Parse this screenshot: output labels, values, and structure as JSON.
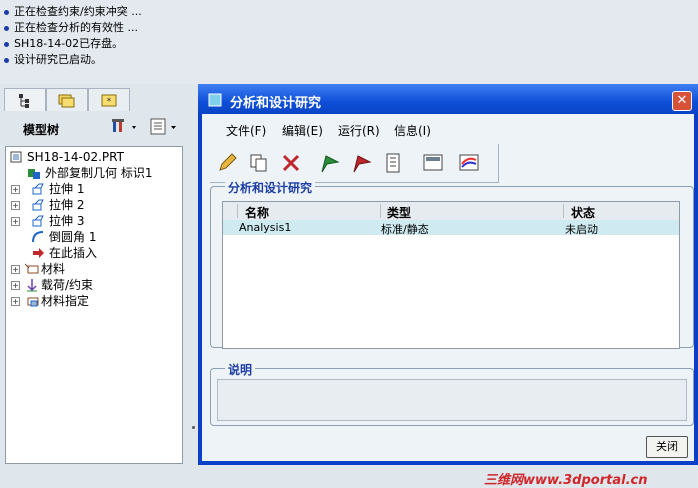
{
  "messages": [
    "正在检查约束/约束冲突 ...",
    "正在检查分析的有效性 ...",
    "SH18-14-02已存盘。",
    "设计研究已启动。"
  ],
  "model_tree": {
    "title": "模型树",
    "root": "SH18-14-02.PRT",
    "nodes": [
      {
        "label": "外部复制几何 标识1",
        "expandable": false
      },
      {
        "label": "拉伸 1",
        "expandable": true
      },
      {
        "label": "拉伸 2",
        "expandable": true
      },
      {
        "label": "拉伸 3",
        "expandable": true
      },
      {
        "label": "倒圆角 1",
        "expandable": false
      },
      {
        "label": "在此插入",
        "expandable": false
      },
      {
        "label": "材料",
        "expandable": true
      },
      {
        "label": "载荷/约束",
        "expandable": true
      },
      {
        "label": "材料指定",
        "expandable": true
      }
    ]
  },
  "dialog": {
    "title": "分析和设计研究",
    "menus": [
      "文件(F)",
      "编辑(E)",
      "运行(R)",
      "信息(I)"
    ],
    "group_title": "分析和设计研究",
    "columns": [
      "名称",
      "类型",
      "状态"
    ],
    "rows": [
      {
        "name": "Analysis1",
        "type": "标准/静态",
        "status": "未启动"
      }
    ],
    "desc_title": "说明",
    "close_label": "关闭"
  },
  "watermark": "三维网www.3dportal.cn"
}
